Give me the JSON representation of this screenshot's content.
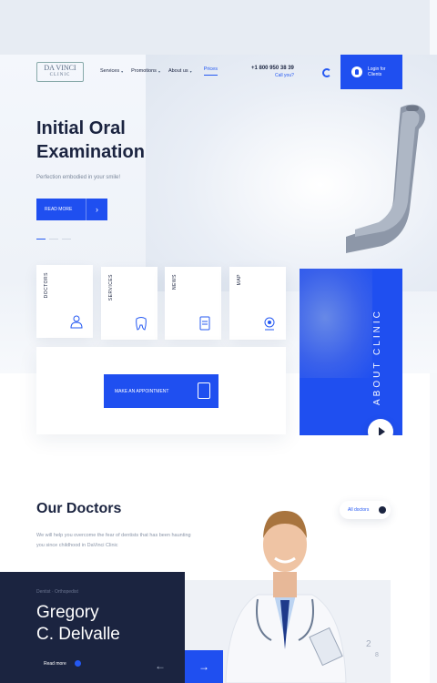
{
  "brand": {
    "logo_line1": "DA VINCI",
    "logo_line2": "CLINIC"
  },
  "nav": {
    "items": [
      {
        "label": "Services",
        "caret": "▾"
      },
      {
        "label": "Promotions",
        "caret": "▾"
      },
      {
        "label": "About us",
        "caret": "▾"
      }
    ],
    "active_label": "Prices",
    "phone": "+1 800 950 38 39",
    "call_label": "Call you?",
    "login_label_line1": "Login for",
    "login_label_line2": "Clients"
  },
  "hero": {
    "title_line1": "Initial Oral",
    "title_line2": "Examination",
    "subtitle": "Perfection embodied in your smile!",
    "cta_label": "READ MORE",
    "cta_arrow": "›",
    "slides_active": 1,
    "slides_total": 3
  },
  "quick_links": [
    {
      "label": "DOCTORS",
      "icon": "doctor-icon"
    },
    {
      "label": "SERVICES",
      "icon": "tooth-icon"
    },
    {
      "label": "NEWS",
      "icon": "document-icon"
    },
    {
      "label": "MAP",
      "icon": "map-pin-icon"
    }
  ],
  "appointment": {
    "label": "MAKE AN APPOINTMENT",
    "icon": "clipboard-icon"
  },
  "about": {
    "label": "ABOUT CLINIC",
    "icon": "play-icon"
  },
  "doctors": {
    "title": "Our Doctors",
    "description": "We will help you overcome the fear of dentists that has been haunting you since childhood in DaVinci Clinic",
    "all_label": "All doctors",
    "featured": {
      "role": "Dentist · Orthopedist",
      "first_name": "Gregory",
      "last_name": "C. Delvalle",
      "read_more": "Read more"
    },
    "pager_current": "2",
    "pager_total": "8",
    "prev_arrow": "←",
    "next_arrow": "→"
  },
  "colors": {
    "accent": "#1f4ff0",
    "dark": "#1b2440",
    "muted": "#8a95a8"
  }
}
